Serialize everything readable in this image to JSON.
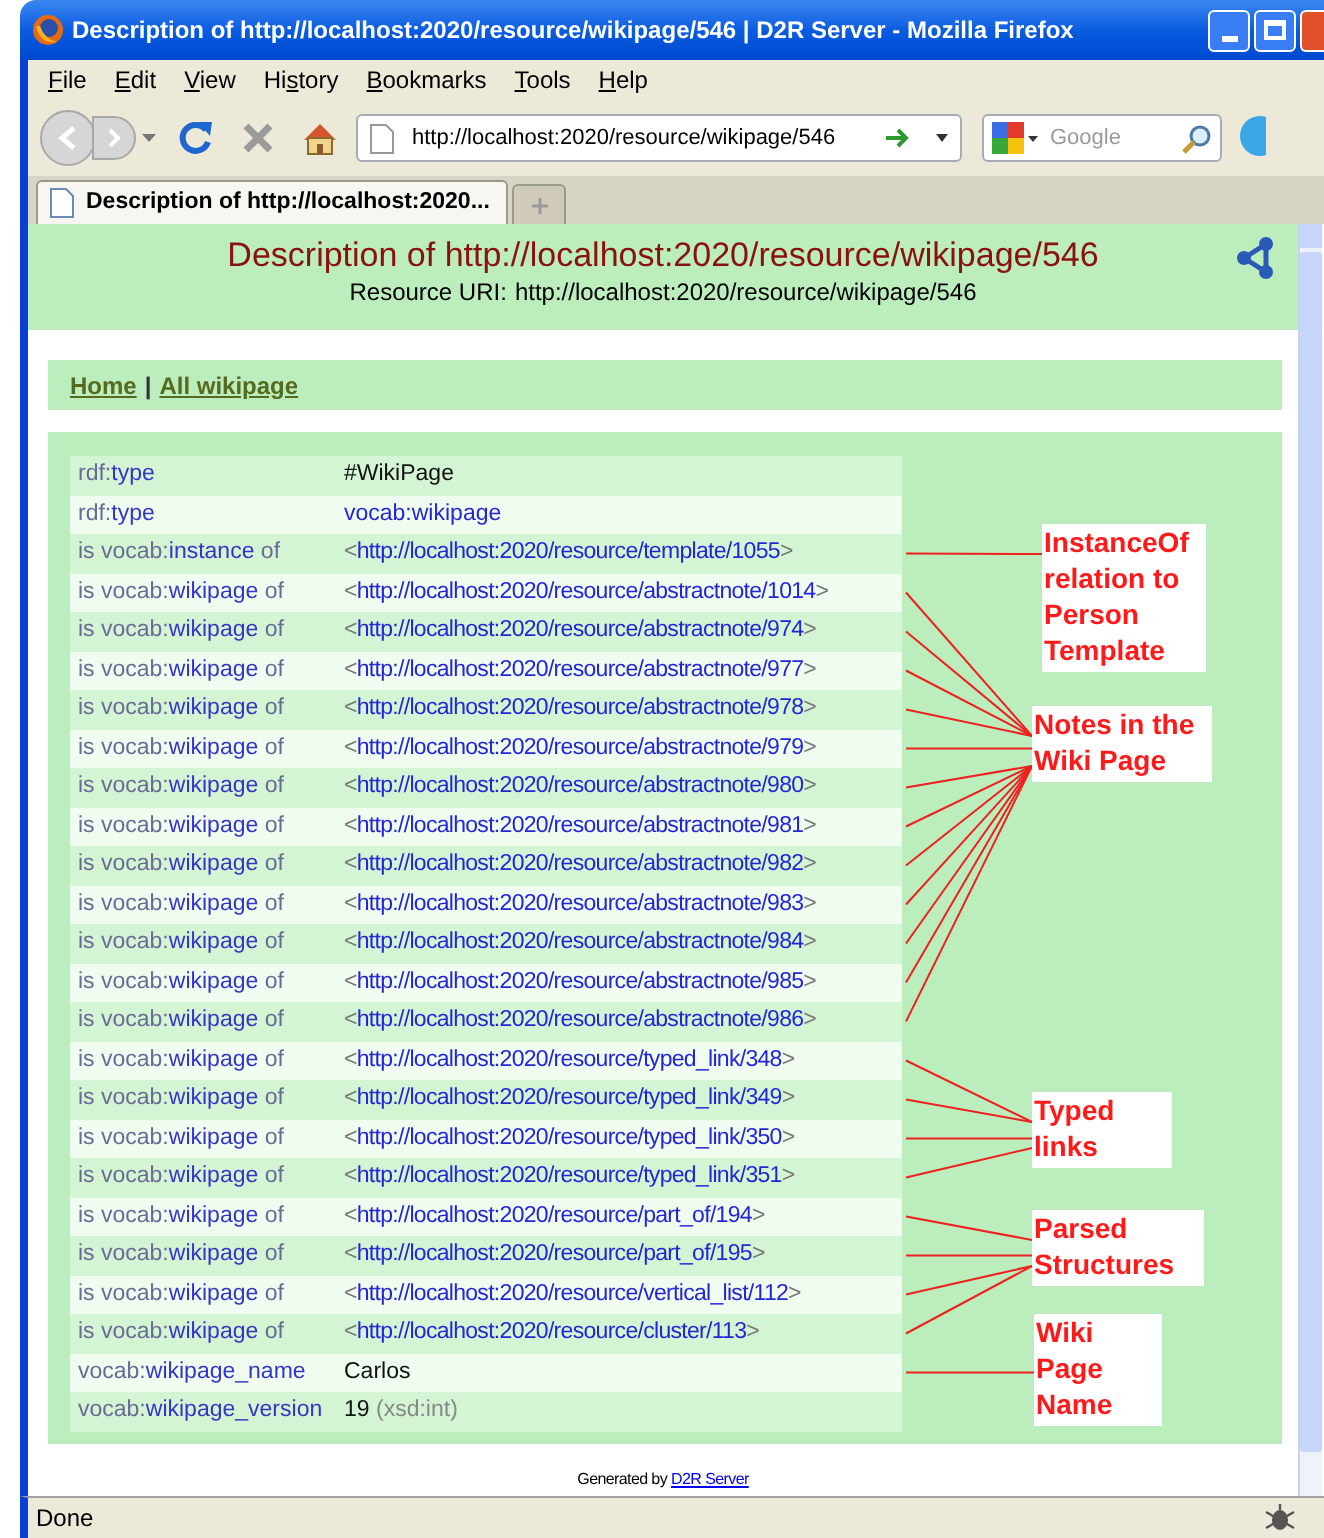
{
  "window": {
    "title": "Description of http://localhost:2020/resource/wikipage/546 | D2R Server - Mozilla Firefox"
  },
  "menu": [
    {
      "accel": "F",
      "after": "ile"
    },
    {
      "accel": "E",
      "after": "dit"
    },
    {
      "accel": "V",
      "after": "iew"
    },
    {
      "before": "Hi",
      "accel": "s",
      "after": "tory"
    },
    {
      "accel": "B",
      "after": "ookmarks"
    },
    {
      "accel": "T",
      "after": "ools"
    },
    {
      "accel": "H",
      "after": "elp"
    }
  ],
  "toolbar": {
    "url": "http://localhost:2020/resource/wikipage/546",
    "search_placeholder": "Google"
  },
  "tabs": [
    {
      "label": "Description of http://localhost:2020...",
      "selected": true
    }
  ],
  "page": {
    "title": "Description of http://localhost:2020/resource/wikipage/546",
    "resource_uri_label": "Resource URI:",
    "resource_uri": "http://localhost:2020/resource/wikipage/546"
  },
  "breadcrumbs": {
    "items": [
      {
        "label": "Home"
      },
      {
        "label": "All wikipage"
      }
    ],
    "separator": "|"
  },
  "row_groups": [
    {
      "rows": [
        {
          "property": {
            "pre": "rdf:",
            "term": "type"
          },
          "value": {
            "kind": "literal",
            "text": "#WikiPage"
          }
        },
        {
          "property": {
            "pre": "rdf:",
            "term": "type"
          },
          "value": {
            "kind": "curie",
            "text": "vocab:wikipage"
          }
        }
      ]
    },
    {
      "annotation": "InstanceOf relation to Person Template",
      "rows": [
        {
          "property": {
            "pre": "is vocab:",
            "term": "instance",
            "post": " of"
          },
          "value": {
            "kind": "uri",
            "open": "<",
            "text": "http://localhost:2020/resource/template/1055",
            "close": ">"
          }
        }
      ]
    },
    {
      "annotation": "Notes in the Wiki Page",
      "rows": [
        {
          "property": {
            "pre": "is vocab:",
            "term": "wikipage",
            "post": " of"
          },
          "value": {
            "kind": "uri",
            "open": "<",
            "text": "http://localhost:2020/resource/abstractnote/1014",
            "close": ">"
          }
        },
        {
          "property": {
            "pre": "is vocab:",
            "term": "wikipage",
            "post": " of"
          },
          "value": {
            "kind": "uri",
            "open": "<",
            "text": "http://localhost:2020/resource/abstractnote/974",
            "close": ">"
          }
        },
        {
          "property": {
            "pre": "is vocab:",
            "term": "wikipage",
            "post": " of"
          },
          "value": {
            "kind": "uri",
            "open": "<",
            "text": "http://localhost:2020/resource/abstractnote/977",
            "close": ">"
          }
        },
        {
          "property": {
            "pre": "is vocab:",
            "term": "wikipage",
            "post": " of"
          },
          "value": {
            "kind": "uri",
            "open": "<",
            "text": "http://localhost:2020/resource/abstractnote/978",
            "close": ">"
          }
        },
        {
          "property": {
            "pre": "is vocab:",
            "term": "wikipage",
            "post": " of"
          },
          "value": {
            "kind": "uri",
            "open": "<",
            "text": "http://localhost:2020/resource/abstractnote/979",
            "close": ">"
          }
        },
        {
          "property": {
            "pre": "is vocab:",
            "term": "wikipage",
            "post": " of"
          },
          "value": {
            "kind": "uri",
            "open": "<",
            "text": "http://localhost:2020/resource/abstractnote/980",
            "close": ">"
          }
        },
        {
          "property": {
            "pre": "is vocab:",
            "term": "wikipage",
            "post": " of"
          },
          "value": {
            "kind": "uri",
            "open": "<",
            "text": "http://localhost:2020/resource/abstractnote/981",
            "close": ">"
          }
        },
        {
          "property": {
            "pre": "is vocab:",
            "term": "wikipage",
            "post": " of"
          },
          "value": {
            "kind": "uri",
            "open": "<",
            "text": "http://localhost:2020/resource/abstractnote/982",
            "close": ">"
          }
        },
        {
          "property": {
            "pre": "is vocab:",
            "term": "wikipage",
            "post": " of"
          },
          "value": {
            "kind": "uri",
            "open": "<",
            "text": "http://localhost:2020/resource/abstractnote/983",
            "close": ">"
          }
        },
        {
          "property": {
            "pre": "is vocab:",
            "term": "wikipage",
            "post": " of"
          },
          "value": {
            "kind": "uri",
            "open": "<",
            "text": "http://localhost:2020/resource/abstractnote/984",
            "close": ">"
          }
        },
        {
          "property": {
            "pre": "is vocab:",
            "term": "wikipage",
            "post": " of"
          },
          "value": {
            "kind": "uri",
            "open": "<",
            "text": "http://localhost:2020/resource/abstractnote/985",
            "close": ">"
          }
        },
        {
          "property": {
            "pre": "is vocab:",
            "term": "wikipage",
            "post": " of"
          },
          "value": {
            "kind": "uri",
            "open": "<",
            "text": "http://localhost:2020/resource/abstractnote/986",
            "close": ">"
          }
        }
      ]
    },
    {
      "annotation": "Typed links",
      "rows": [
        {
          "property": {
            "pre": "is vocab:",
            "term": "wikipage",
            "post": " of"
          },
          "value": {
            "kind": "uri",
            "open": "<",
            "text": "http://localhost:2020/resource/typed_link/348",
            "close": ">"
          }
        },
        {
          "property": {
            "pre": "is vocab:",
            "term": "wikipage",
            "post": " of"
          },
          "value": {
            "kind": "uri",
            "open": "<",
            "text": "http://localhost:2020/resource/typed_link/349",
            "close": ">"
          }
        },
        {
          "property": {
            "pre": "is vocab:",
            "term": "wikipage",
            "post": " of"
          },
          "value": {
            "kind": "uri",
            "open": "<",
            "text": "http://localhost:2020/resource/typed_link/350",
            "close": ">"
          }
        },
        {
          "property": {
            "pre": "is vocab:",
            "term": "wikipage",
            "post": " of"
          },
          "value": {
            "kind": "uri",
            "open": "<",
            "text": "http://localhost:2020/resource/typed_link/351",
            "close": ">"
          }
        }
      ]
    },
    {
      "annotation": "Parsed Structures",
      "rows": [
        {
          "property": {
            "pre": "is vocab:",
            "term": "wikipage",
            "post": " of"
          },
          "value": {
            "kind": "uri",
            "open": "<",
            "text": "http://localhost:2020/resource/part_of/194",
            "close": ">"
          }
        },
        {
          "property": {
            "pre": "is vocab:",
            "term": "wikipage",
            "post": " of"
          },
          "value": {
            "kind": "uri",
            "open": "<",
            "text": "http://localhost:2020/resource/part_of/195",
            "close": ">"
          }
        },
        {
          "property": {
            "pre": "is vocab:",
            "term": "wikipage",
            "post": " of"
          },
          "value": {
            "kind": "uri",
            "open": "<",
            "text": "http://localhost:2020/resource/vertical_list/112",
            "close": ">"
          }
        },
        {
          "property": {
            "pre": "is vocab:",
            "term": "wikipage",
            "post": " of"
          },
          "value": {
            "kind": "uri",
            "open": "<",
            "text": "http://localhost:2020/resource/cluster/113",
            "close": ">"
          }
        }
      ]
    },
    {
      "annotation": "Wiki Page Name",
      "rows": [
        {
          "property": {
            "pre": "vocab:",
            "term": "wikipage_name"
          },
          "value": {
            "kind": "literal",
            "text": "Carlos"
          }
        }
      ]
    },
    {
      "rows": [
        {
          "property": {
            "pre": "vocab:",
            "term": "wikipage_version"
          },
          "value": {
            "kind": "literal",
            "text": "19",
            "datatype": "(xsd:int)"
          }
        }
      ]
    }
  ],
  "footer": {
    "text": "Generated by",
    "link": "D2R Server"
  },
  "status_bar": {
    "text": "Done"
  }
}
